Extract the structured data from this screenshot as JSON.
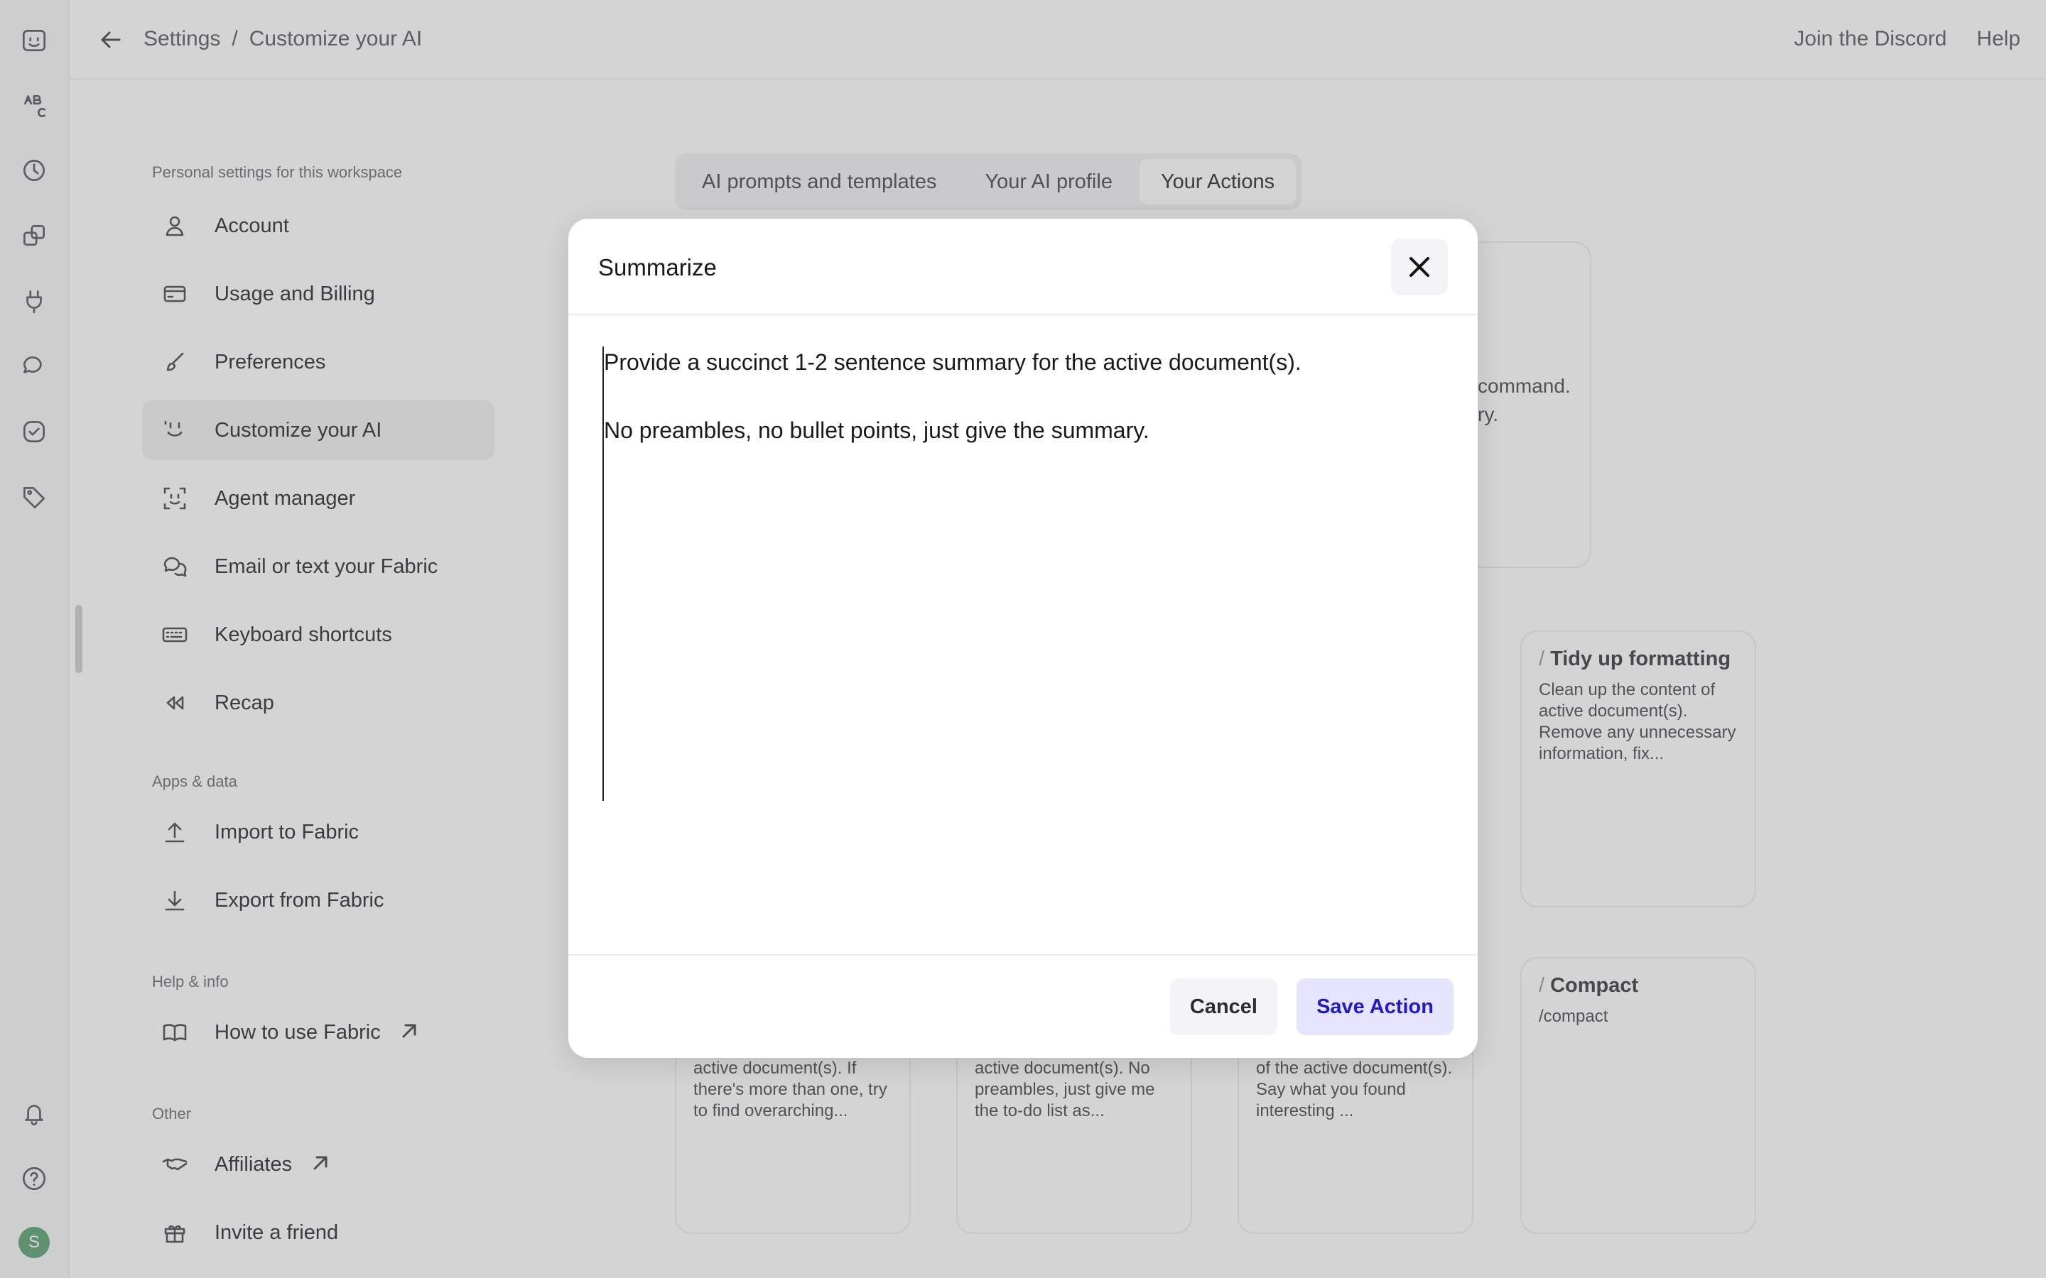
{
  "breadcrumb": {
    "root": "Settings",
    "separator": "/",
    "current": "Customize your AI"
  },
  "topbar": {
    "discord": "Join the Discord",
    "help": "Help"
  },
  "nav": {
    "section_personal": "Personal settings for this workspace",
    "items": [
      {
        "label": "Account",
        "icon": "person-icon"
      },
      {
        "label": "Usage and Billing",
        "icon": "credit-card-icon"
      },
      {
        "label": "Preferences",
        "icon": "brush-icon"
      },
      {
        "label": "Customize your AI",
        "icon": "smile-icon"
      },
      {
        "label": "Agent manager",
        "icon": "agent-face-icon"
      },
      {
        "label": "Email or text your Fabric",
        "icon": "chat-bubbles-icon"
      },
      {
        "label": "Keyboard shortcuts",
        "icon": "keyboard-icon"
      },
      {
        "label": "Recap",
        "icon": "rewind-icon"
      }
    ],
    "section_apps": "Apps & data",
    "apps": [
      {
        "label": "Import to Fabric",
        "icon": "upload-icon"
      },
      {
        "label": "Export from Fabric",
        "icon": "download-icon"
      }
    ],
    "section_help": "Help & info",
    "help": [
      {
        "label": "How to use Fabric",
        "icon": "book-icon"
      }
    ],
    "section_other": "Other",
    "other": [
      {
        "label": "Affiliates",
        "icon": "handshake-icon"
      },
      {
        "label": "Invite a friend",
        "icon": "gift-icon"
      }
    ]
  },
  "tabs": [
    "AI prompts and templates",
    "Your AI profile",
    "Your Actions"
  ],
  "active_tab": "Your Actions",
  "hint": {
    "line1": "command.",
    "line2": "ry."
  },
  "cards": [
    {
      "slash": "/",
      "title": "Tidy up formatting",
      "desc": "Clean up the content of active document(s). Remove any unnecessary information, fix..."
    },
    {
      "slash": "/",
      "title": "Compact",
      "desc": "/compact"
    },
    {
      "title": "",
      "desc": "active document(s). If there's more than one, try to find overarching..."
    },
    {
      "title": "",
      "desc": "active document(s). No preambles, just give me the to-do list as..."
    },
    {
      "title": "",
      "desc": "of the active document(s). Say what you found interesting ..."
    }
  ],
  "rail": {
    "avatar_letter": "S"
  },
  "modal": {
    "title": "Summarize",
    "line1": "Provide a succinct 1-2 sentence summary for the active document(s).",
    "line2": "No preambles, no bullet points, just give the summary.",
    "cancel": "Cancel",
    "save": "Save Action"
  },
  "colors": {
    "accent": "#2219c9",
    "accent_bg": "#e7e4ff",
    "avatar": "#5aa373"
  }
}
